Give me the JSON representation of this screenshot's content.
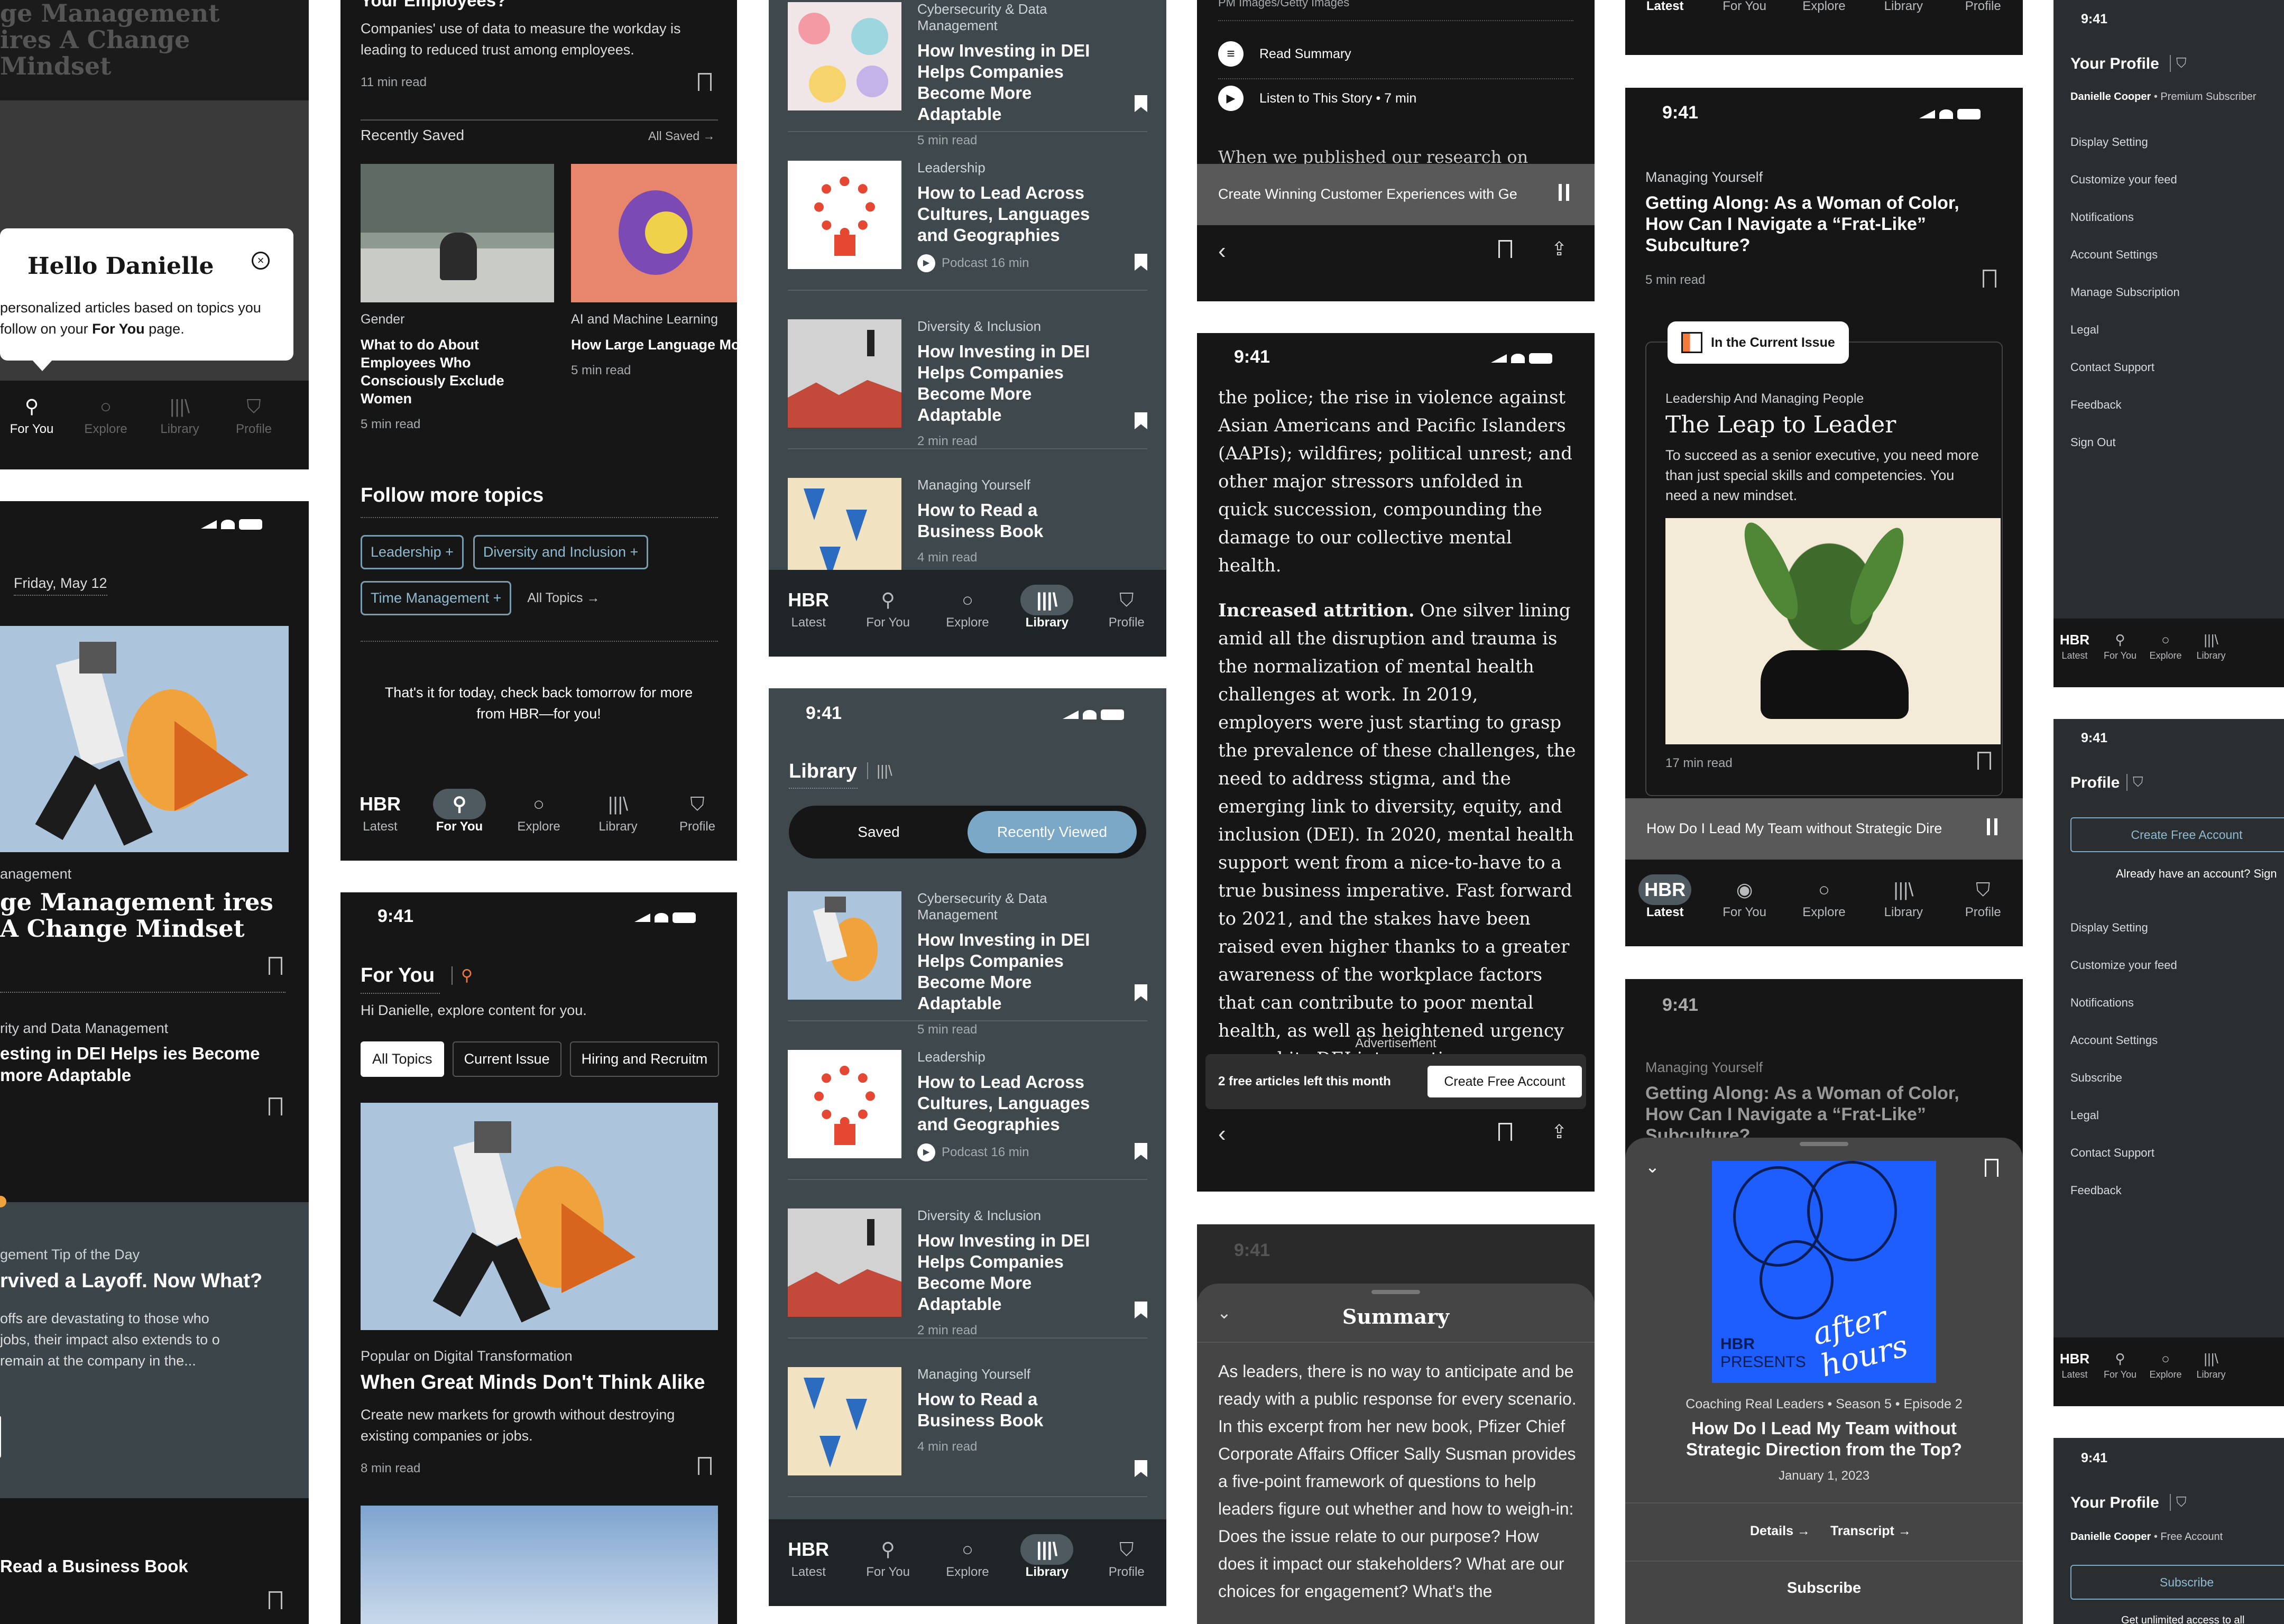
{
  "status": {
    "time": "9:41"
  },
  "tabs": {
    "hbr": "HBR",
    "latest": "Latest",
    "for_you": "For You",
    "explore": "Explore",
    "library": "Library",
    "profile": "Profile"
  },
  "c1": {
    "top_headline": "ge Management ires A Change Mindset",
    "popup_title": "Hello Danielle",
    "popup_body": "personalized articles based on topics you follow on your",
    "popup_link": "For You",
    "popup_end": "page.",
    "date": "Friday, May 12",
    "cat1": "anagement",
    "head1": "ge Management ires A Change Mindset",
    "cat2": "rity and Data Management",
    "head2": "esting in DEI Helps ies Become more Adaptable",
    "tip_cat": "gement Tip of the Day",
    "tip_head": "rvived a Layoff. Now What?",
    "tip_body": "offs are devastating to those who jobs, their impact also extends to o remain at the company in the...",
    "bottom_head": "Read a Business Book"
  },
  "c2": {
    "top_title": "Your Employees?",
    "top_body": "Companies' use of data to measure the workday is leading to reduced trust among employees.",
    "top_meta": "11 min read",
    "recent_label": "Recently Saved",
    "all_saved": "All Saved →",
    "saved": [
      {
        "cat": "Gender",
        "title": "What to do About Employees Who Consciously Exclude Women",
        "meta": "5 min read"
      },
      {
        "cat": "AI and Machine Learning",
        "title": "How Large Language Mo Reflect Human Judgm",
        "meta": "5 min read"
      }
    ],
    "follow_title": "Follow more topics",
    "topics": [
      "Leadership +",
      "Diversity and Inclusion +",
      "Time Management +"
    ],
    "all_topics": "All Topics →",
    "end_msg": "That's it for today, check back tomorrow for more from HBR—for you!",
    "fy_title": "For You",
    "fy_sub": "Hi Danielle, explore content for you.",
    "chips": [
      "All Topics",
      "Current Issue",
      "Hiring and Recruitm"
    ],
    "feat_cat": "Popular on Digital Transformation",
    "feat_title": "When Great Minds Don't Think Alike",
    "feat_body": "Create new markets for growth without destroying existing companies or jobs.",
    "feat_meta": "8 min read"
  },
  "c3": {
    "cards": [
      {
        "cat": "Cybersecurity & Data Management",
        "title": "How Investing in DEI Helps Companies Become More Adaptable",
        "meta": "5 min read"
      },
      {
        "cat": "Leadership",
        "title": "How to Lead Across Cultures, Languages and Geographies",
        "meta": "Podcast 16 min"
      },
      {
        "cat": "Diversity & Inclusion",
        "title": "How Investing in DEI Helps Companies Become More Adaptable",
        "meta": "2 min read"
      },
      {
        "cat": "Managing Yourself",
        "title": "How to Read a Business Book",
        "meta": "4 min read"
      }
    ],
    "lib_title": "Library",
    "seg_saved": "Saved",
    "seg_recent": "Recently Viewed"
  },
  "c4": {
    "credit": "PM Images/Getty Images",
    "read_summary": "Read Summary",
    "listen": "Listen to This Story • 7 min",
    "peek": "When we published our research on",
    "player": "Create Winning Customer Experiences with Ge",
    "art_p1": "the police; the rise in violence against Asian Americans and Pacific Islanders (AAPIs); wildfires; political unrest; and other major stressors unfolded in quick succession, compounding the damage to our collective mental health.",
    "art_lead": "Increased attrition.",
    "art_p2": " One silver lining amid all the disruption and trauma is the normalization of mental health challenges at work. In 2019, employers were just starting to grasp the prevalence of these challenges, the need to address stigma, and the emerging link to diversity, equity, and inclusion (DEI). In 2020, mental health support went from a nice-to-have to a true business imperative. Fast forward to 2021, and the stakes have been raised even higher thanks to a greater awareness of the workplace factors that can contribute to poor mental health, as well as heightened urgency around its DEI intersections.",
    "ad_label": "Advertisement",
    "free_left": "2 free articles left this month",
    "create_account": "Create Free Account",
    "summary_title": "Summary",
    "summary_body": "As leaders, there is no way to anticipate and be ready with a public response for every scenario. In this excerpt from her new book, Pfizer Chief Corporate Affairs Officer Sally Susman provides a five-point framework of questions to help leaders figure out whether and how to weigh-in: Does the issue relate to our purpose? How does it impact our stakeholders? What are our choices for engagement? What's the"
  },
  "c5": {
    "cat": "Managing Yourself",
    "title": "Getting Along: As a Woman of Color, How Can I Navigate a “Frat-Like” Subculture?",
    "meta": "5 min read",
    "badge": "In the Current Issue",
    "issue_cat": "Leadership And Managing People",
    "issue_title": "The Leap to Leader",
    "issue_body": "To succeed as a senior executive, you need more than just special skills and competencies. You need a new mindset.",
    "issue_meta": "17 min read",
    "player": "How Do I Lead My Team without Strategic Dire",
    "pod_label_hbr": "HBR",
    "pod_label_presents": "PRESENTS",
    "pod_art": "after hours",
    "pod_meta": "Coaching Real Leaders • Season 5 • Episode 2",
    "pod_title": "How Do I Lead My Team without Strategic Direction from the Top?",
    "pod_date": "January 1, 2023",
    "details": "Details →",
    "transcript": "Transcript →",
    "subscribe": "Subscribe"
  },
  "c6": {
    "your_profile": "Your Profile",
    "user_premium": "Danielle Cooper",
    "premium": " • Premium Subscriber",
    "menu1": [
      "Display Setting",
      "Customize your feed",
      "Notifications",
      "Account Settings",
      "Manage Subscription",
      "Legal",
      "Contact Support",
      "Feedback",
      "Sign Out"
    ],
    "profile": "Profile",
    "create": "Create Free Account",
    "already": "Already have an account? Sign",
    "menu2": [
      "Display Setting",
      "Customize your feed",
      "Notifications",
      "Account Settings",
      "Subscribe",
      "Legal",
      "Contact Support",
      "Feedback"
    ],
    "user_free": "Danielle Cooper",
    "free": " • Free Account",
    "subscribe": "Subscribe",
    "unlimited": "Get unlimited access to all"
  }
}
